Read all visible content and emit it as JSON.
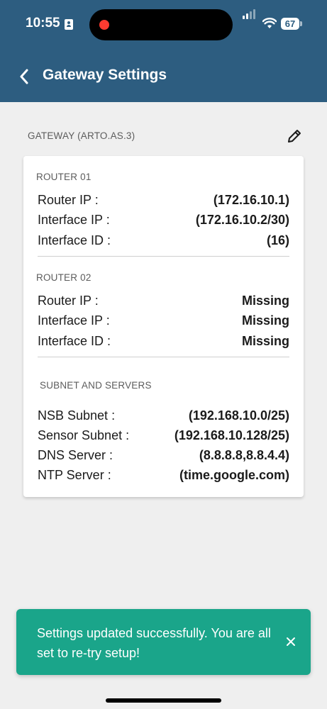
{
  "status_bar": {
    "time": "10:55",
    "battery": "67"
  },
  "header": {
    "title": "Gateway Settings",
    "back_icon": "chevron-left-icon",
    "background": "#2d5d80"
  },
  "section": {
    "label": "GATEWAY (ARTO.AS.3)",
    "edit_icon": "pencil-icon"
  },
  "card": {
    "router1": {
      "title": "ROUTER 01",
      "rows": [
        {
          "label": "Router IP :",
          "value": "(172.16.10.1)"
        },
        {
          "label": "Interface IP :",
          "value": "(172.16.10.2/30)"
        },
        {
          "label": "Interface ID :",
          "value": "(16)"
        }
      ]
    },
    "router2": {
      "title": "ROUTER 02",
      "rows": [
        {
          "label": "Router IP :",
          "value": "Missing"
        },
        {
          "label": "Interface IP :",
          "value": "Missing"
        },
        {
          "label": "Interface ID :",
          "value": "Missing"
        }
      ]
    },
    "subnet": {
      "title": "SUBNET AND SERVERS",
      "rows": [
        {
          "label": "NSB Subnet :",
          "value": "(192.168.10.0/25)"
        },
        {
          "label": "Sensor Subnet :",
          "value": "(192.168.10.128/25)"
        },
        {
          "label": "DNS Server :",
          "value": "(8.8.8.8,8.8.4.4)"
        },
        {
          "label": "NTP Server :",
          "value": "(time.google.com)"
        }
      ]
    }
  },
  "toast": {
    "message": "Settings updated successfully. You are all set to re-try setup!",
    "close_icon": "close-icon",
    "color": "#1aa58a"
  }
}
